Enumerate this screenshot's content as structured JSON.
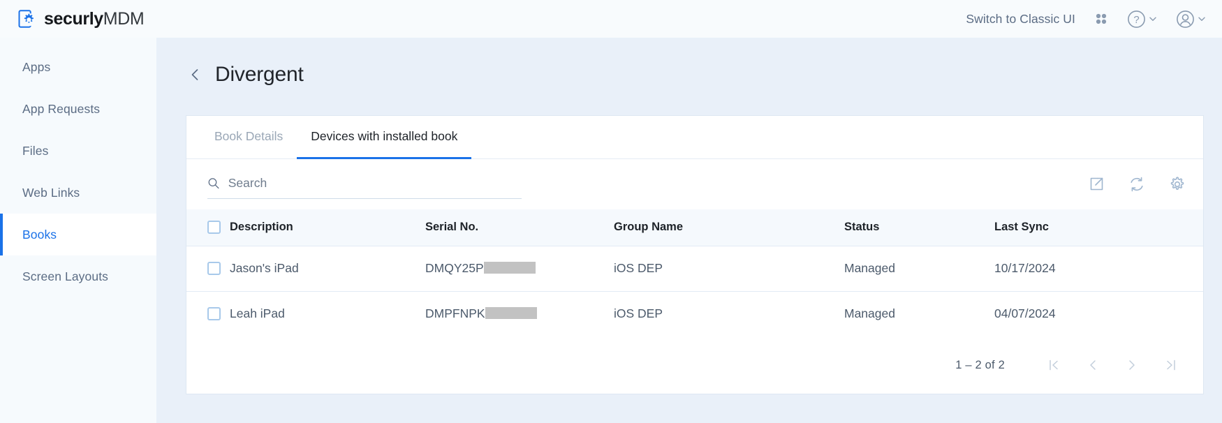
{
  "topbar": {
    "brand_bold": "securly",
    "brand_light": "MDM",
    "brand_icon": "device-gear-logo-icon",
    "switch_label": "Switch to Classic UI",
    "grid_icon": "app-grid-icon",
    "help_icon": "help-circle-icon",
    "help_chevron_icon": "chevron-down-icon",
    "account_icon": "user-avatar-icon",
    "account_chevron_icon": "chevron-down-icon",
    "accent": "#1b72e8"
  },
  "sidebar": {
    "items": [
      {
        "label": "Apps",
        "active": false
      },
      {
        "label": "App Requests",
        "active": false
      },
      {
        "label": "Files",
        "active": false
      },
      {
        "label": "Web Links",
        "active": false
      },
      {
        "label": "Books",
        "active": true
      },
      {
        "label": "Screen Layouts",
        "active": false
      }
    ]
  },
  "page": {
    "back_icon": "chevron-left-icon",
    "title": "Divergent"
  },
  "tabs": [
    {
      "label": "Book Details",
      "active": false
    },
    {
      "label": "Devices with installed book",
      "active": true
    }
  ],
  "toolbar": {
    "search_icon": "search-icon",
    "search_value": "",
    "search_placeholder": "Search",
    "export_icon": "export-icon",
    "refresh_icon": "refresh-icon",
    "settings_icon": "gear-icon"
  },
  "table": {
    "select_all_checkbox": "select-all-checkbox",
    "columns": [
      "Description",
      "Serial No.",
      "Group Name",
      "Status",
      "Last Sync"
    ],
    "rows": [
      {
        "description": "Jason's iPad",
        "serial": "DMQY25P",
        "serial_redacted": true,
        "group": "iOS DEP",
        "status": "Managed",
        "last_sync": "10/17/2024"
      },
      {
        "description": "Leah iPad",
        "serial": "DMPFNPK",
        "serial_redacted": true,
        "group": "iOS DEP",
        "status": "Managed",
        "last_sync": "04/07/2024"
      }
    ]
  },
  "pagination": {
    "range": "1 – 2 of 2",
    "first_icon": "first-page-icon",
    "prev_icon": "prev-page-icon",
    "next_icon": "next-page-icon",
    "last_icon": "last-page-icon"
  }
}
